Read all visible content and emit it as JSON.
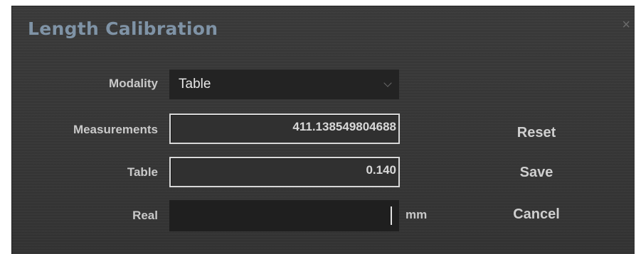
{
  "dialog": {
    "title": "Length Calibration",
    "close_symbol": "×"
  },
  "form": {
    "modality_label": "Modality",
    "modality_value": "Table",
    "measurements_label": "Measurements",
    "measurements_value": "411.138549804688",
    "table_label": "Table",
    "table_value": "0.140",
    "real_label": "Real",
    "real_value": "",
    "real_unit": "mm"
  },
  "buttons": {
    "reset": "Reset",
    "save": "Save",
    "cancel": "Cancel"
  },
  "icons": {
    "close": "close-icon",
    "dropdown": "chevron-down-icon"
  },
  "colors": {
    "title": "#7f93a6",
    "background": "#363636",
    "label": "#c9c9c9"
  }
}
